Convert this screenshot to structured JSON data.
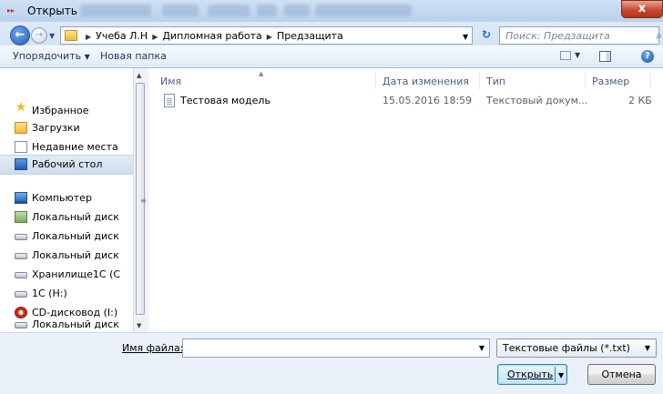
{
  "window": {
    "title": "Открыть",
    "close_label": "x"
  },
  "address": {
    "crumbs": [
      "Учеба Л.Н",
      "Дипломная работа",
      "Предзащита"
    ],
    "search_placeholder": "Поиск: Предзащита"
  },
  "toolbar": {
    "organize_label": "Упорядочить",
    "new_folder_label": "Новая папка"
  },
  "nav": {
    "items": [
      {
        "label": "Избранное",
        "icon": "star-icon"
      },
      {
        "label": "Загрузки",
        "icon": "downloads-folder-icon"
      },
      {
        "label": "Недавние места",
        "icon": "recent-places-icon"
      },
      {
        "label": "Рабочий стол",
        "icon": "desktop-icon",
        "selected": true
      },
      {
        "label": "Компьютер",
        "icon": "computer-icon"
      },
      {
        "label": "Локальный диск",
        "icon": "system-disk-icon"
      },
      {
        "label": "Локальный диск",
        "icon": "hard-disk-icon"
      },
      {
        "label": "Локальный диск",
        "icon": "hard-disk-icon"
      },
      {
        "label": "Хранилище1С (С",
        "icon": "hard-disk-icon"
      },
      {
        "label": "1С (H:)",
        "icon": "hard-disk-icon"
      },
      {
        "label": "CD-дисковод (I:)",
        "icon": "cd-drive-icon"
      },
      {
        "label": "Локальный диск",
        "icon": "hard-disk-icon"
      }
    ]
  },
  "list": {
    "columns": {
      "name": "Имя",
      "date": "Дата изменения",
      "type": "Тип",
      "size": "Размер"
    },
    "rows": [
      {
        "name": "Тестовая модель",
        "date": "15.05.2016 18:59",
        "type": "Текстовый докум...",
        "size": "2 КБ"
      }
    ]
  },
  "footer": {
    "filename_label": "Имя файла:",
    "filename_value": "",
    "filter_value": "Текстовые файлы (*.txt)",
    "open_label": "Открыть",
    "cancel_label": "Отмена"
  }
}
